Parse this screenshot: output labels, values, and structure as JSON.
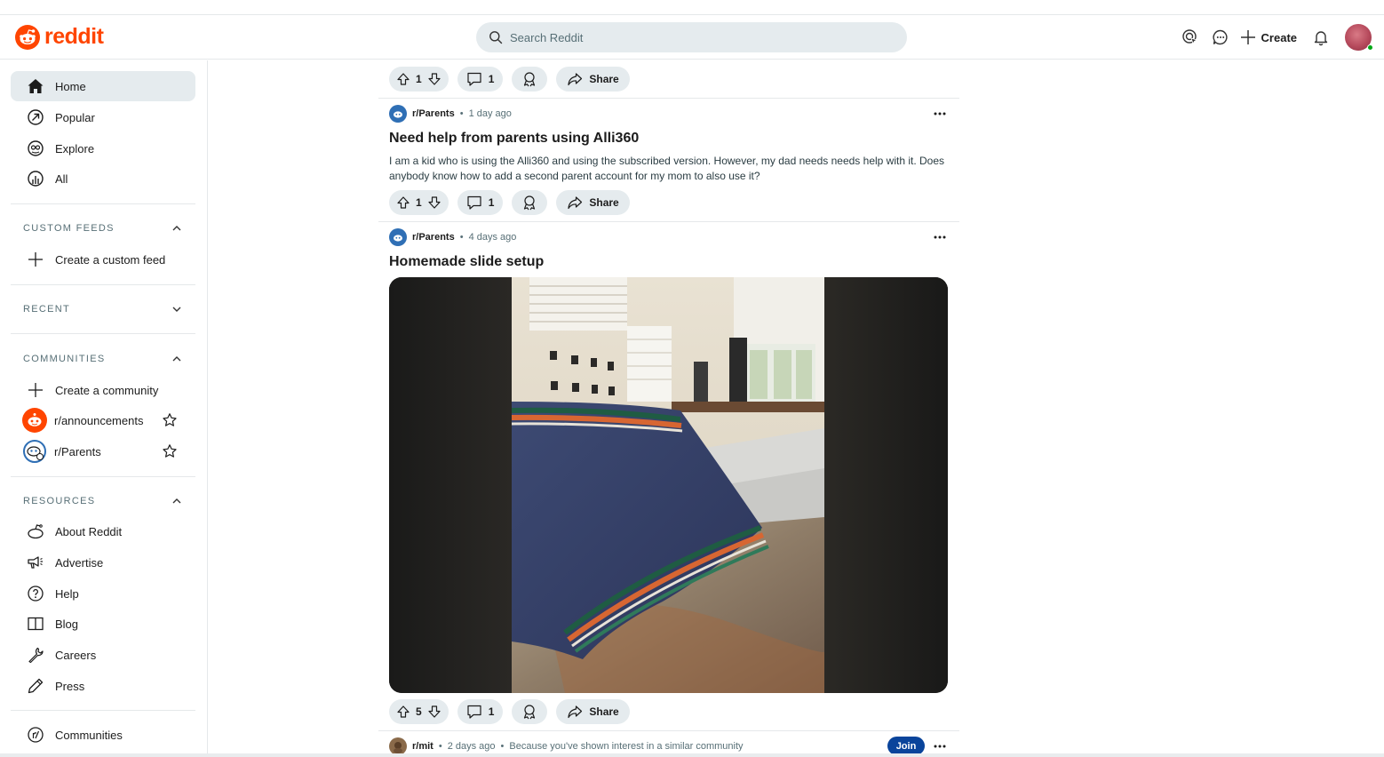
{
  "header": {
    "logo_text": "reddit",
    "search_placeholder": "Search Reddit",
    "create_label": "Create",
    "icons": [
      "advertise-icon",
      "chat-icon",
      "plus-icon",
      "bell-icon"
    ]
  },
  "sidebar": {
    "nav": [
      {
        "label": "Home",
        "icon": "home-icon",
        "active": true
      },
      {
        "label": "Popular",
        "icon": "popular-icon"
      },
      {
        "label": "Explore",
        "icon": "explore-icon"
      },
      {
        "label": "All",
        "icon": "all-icon"
      }
    ],
    "custom_feeds": {
      "header": "CUSTOM FEEDS",
      "create_label": "Create a custom feed"
    },
    "recent": {
      "header": "RECENT"
    },
    "communities": {
      "header": "COMMUNITIES",
      "create_label": "Create a community",
      "items": [
        {
          "label": "r/announcements",
          "color": "#ff4500"
        },
        {
          "label": "r/Parents",
          "color": "#2f6fb5"
        }
      ]
    },
    "resources": {
      "header": "RESOURCES",
      "items": [
        {
          "label": "About Reddit",
          "icon": "reddit-alien-icon"
        },
        {
          "label": "Advertise",
          "icon": "megaphone-icon"
        },
        {
          "label": "Help",
          "icon": "help-icon"
        },
        {
          "label": "Blog",
          "icon": "book-icon"
        },
        {
          "label": "Careers",
          "icon": "wrench-icon"
        },
        {
          "label": "Press",
          "icon": "pen-icon"
        }
      ]
    },
    "communities_link": "Communities"
  },
  "feed": {
    "top_actions": {
      "votes": "1",
      "comments": "1",
      "share": "Share"
    },
    "posts": [
      {
        "subreddit": "r/Parents",
        "time": "1 day ago",
        "title": "Need help from parents using Alli360",
        "body": "I am a kid who is using the Alli360 and using the subscribed version. However, my dad needs needs help with it. Does anybody know how to add a second parent account for my mom to also use it?",
        "votes": "1",
        "comments": "1",
        "share": "Share"
      },
      {
        "subreddit": "r/Parents",
        "time": "4 days ago",
        "title": "Homemade slide setup",
        "votes": "5",
        "comments": "1",
        "share": "Share"
      },
      {
        "subreddit": "r/mit",
        "time": "2 days ago",
        "reason": "Because you've shown interest in a similar community",
        "join_label": "Join"
      }
    ]
  },
  "colors": {
    "brand": "#ff4500",
    "join": "#0a449b",
    "pill": "#e5ebee"
  }
}
